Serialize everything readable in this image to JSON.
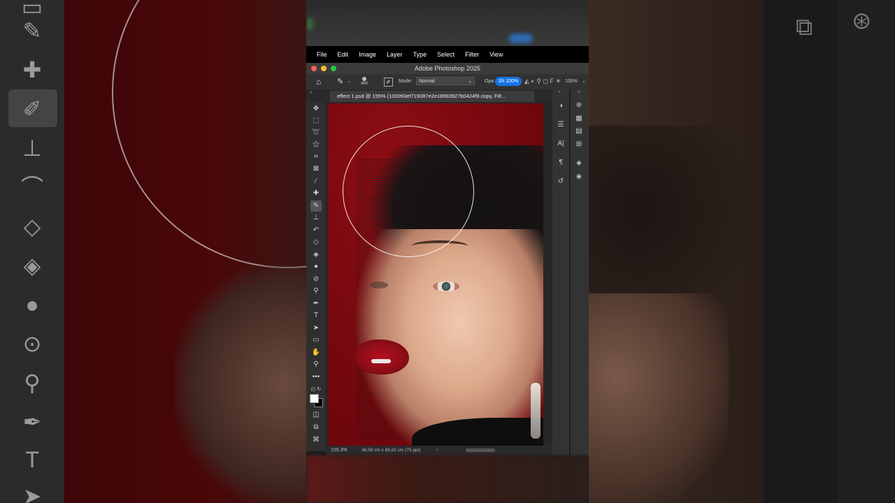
{
  "app": {
    "window_title": "Adobe Photoshop 2025",
    "menu": [
      "File",
      "Edit",
      "Image",
      "Layer",
      "Type",
      "Select",
      "Filter",
      "View"
    ]
  },
  "options_bar": {
    "brush_size": "460",
    "mode_label": "Mode:",
    "mode_value": "Normal",
    "opacity_label": "Opa",
    "flow_pill": "Sh 100%",
    "smoothing_label": "F",
    "smoothing_value": "100%"
  },
  "document": {
    "tab_label": "effect 1.psd @ 155% (100093ef719087e2e18693927b0424f9 copy, Filt...",
    "tab_close": "×"
  },
  "status_bar": {
    "zoom": "155,3%",
    "doc_info": "36,58 cm x 65,02 cm (75 ppi)",
    "arrow": "›"
  },
  "colors": {
    "accent": "#1473e6",
    "canvas_bg": "#7a0a10",
    "ui_dark": "#2f2f2f"
  },
  "toolbar": {
    "tools": [
      "move-icon",
      "marquee-icon",
      "lasso-icon",
      "magic-wand-icon",
      "crop-icon",
      "frame-icon",
      "eyedropper-icon",
      "healing-brush-icon",
      "brush-icon",
      "clone-stamp-icon",
      "history-brush-icon",
      "eraser-icon",
      "paint-bucket-icon",
      "blur-icon",
      "dodge-icon",
      "dodge-tool-icon",
      "pen-icon",
      "type-icon",
      "path-select-icon",
      "rectangle-icon",
      "hand-icon",
      "zoom-icon",
      "more-tools-icon"
    ],
    "bottom_tools": [
      "quick-mask-icon",
      "screen-mode-icon",
      "artboard-icon"
    ]
  },
  "panels": {
    "col1": [
      "color-icon",
      "adjustments-icon",
      "character-icon",
      "paragraph-icon",
      "history-icon"
    ],
    "col2": [
      "properties-icon",
      "table-icon",
      "gradient-icon",
      "grid-icon",
      "layers-icon",
      "channels-icon"
    ]
  }
}
